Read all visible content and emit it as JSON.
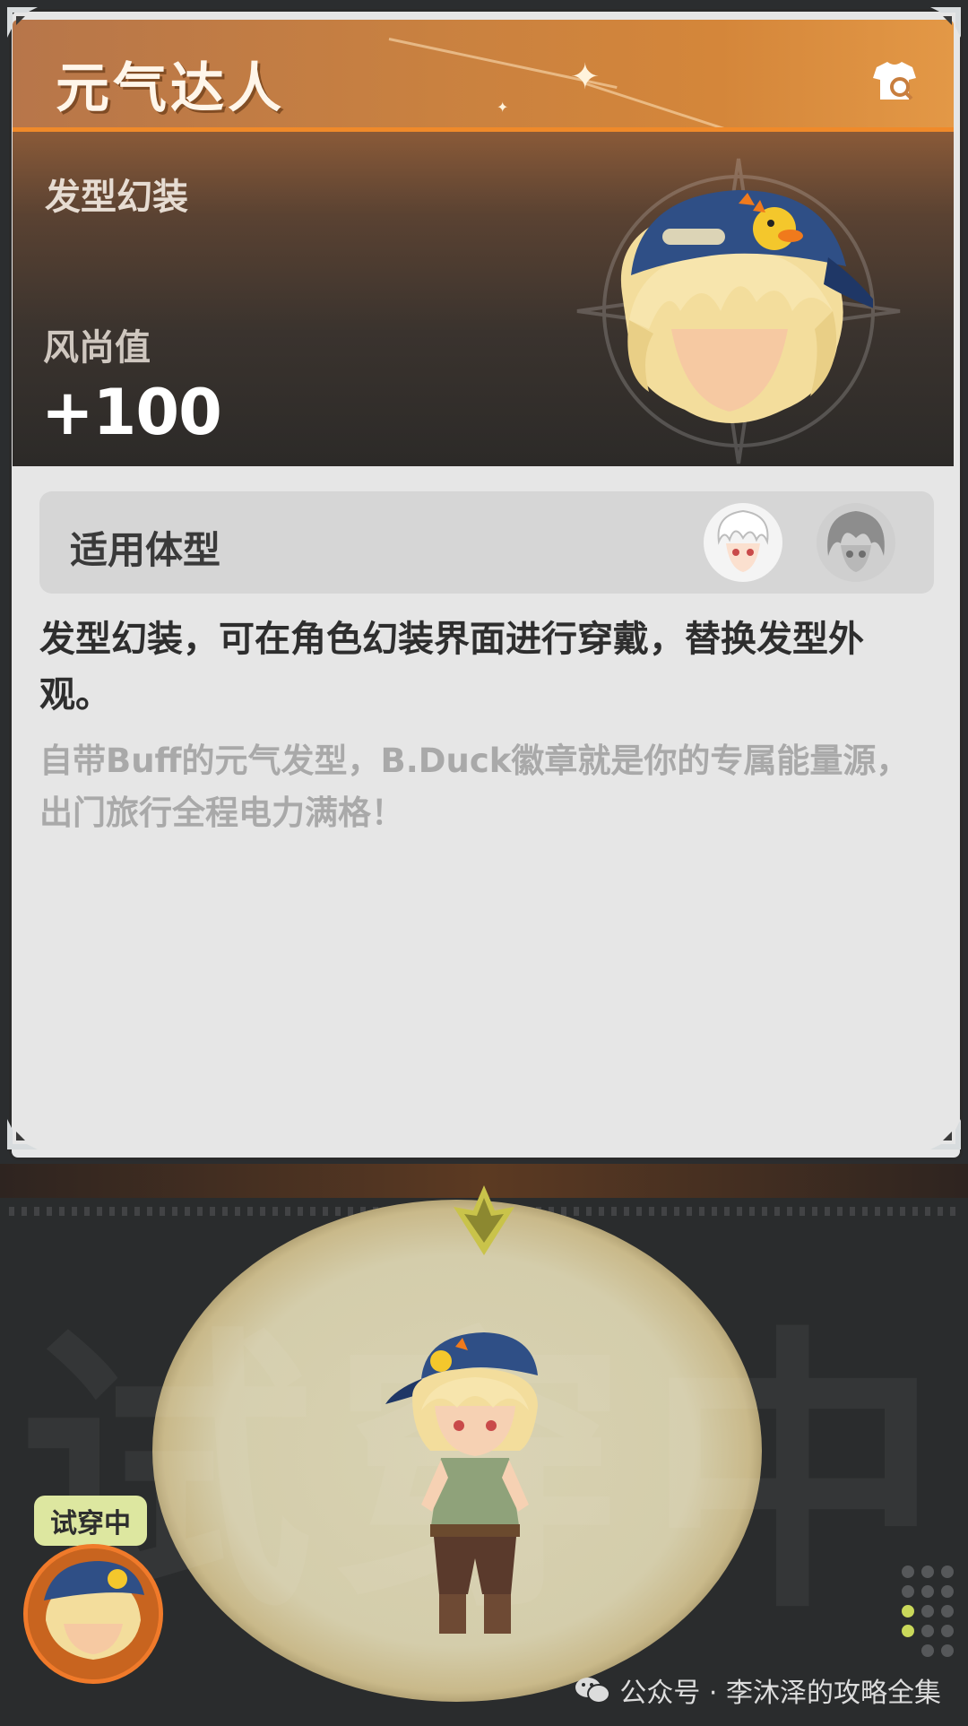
{
  "item": {
    "title": "元气达人",
    "category": "发型幻装",
    "style_label": "风尚值",
    "style_value": "+100",
    "body_type_label": "适用体型",
    "description": "发型幻装，可在角色幻装界面进行穿戴，替换发型外观。",
    "flavor": "自带Buff的元气发型，B.Duck徽章就是你的专属能量源，出门旅行全程电力满格！"
  },
  "tryon": {
    "watermark": "试穿中",
    "badge": "试穿中"
  },
  "footer": {
    "source": "公众号 · 李沐泽的攻略全集"
  },
  "colors": {
    "accent_orange": "#f08a2a",
    "badge_green": "#dde7a0",
    "dot_active": "#c9d85a"
  }
}
